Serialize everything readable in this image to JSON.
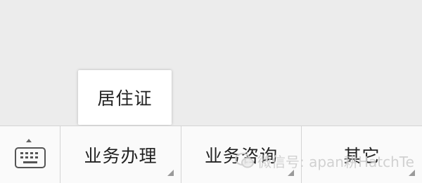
{
  "popup_menu": {
    "items": [
      {
        "label": "居住证"
      }
    ]
  },
  "bottom_menu": {
    "keyboard_toggle_icon": "keyboard-icon",
    "tabs": [
      {
        "label": "业务办理"
      },
      {
        "label": "业务咨询"
      },
      {
        "label": "其它"
      }
    ]
  },
  "watermark": {
    "text": "微信号: apan耕HatchTe"
  },
  "colors": {
    "background": "#ececec",
    "bar_background": "#fafafa",
    "divider": "#d4d4d4",
    "text": "#222222"
  }
}
